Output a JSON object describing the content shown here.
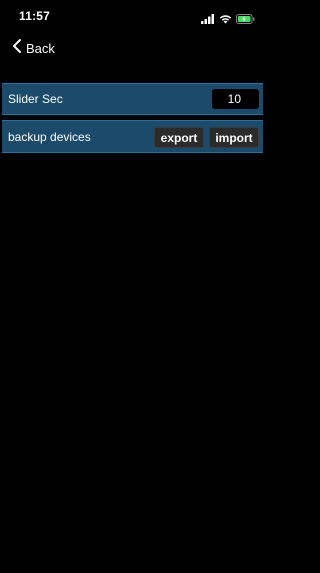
{
  "status_bar": {
    "time": "11:57",
    "icons": [
      "cellular-signal-icon",
      "wifi-icon",
      "battery-charging-icon"
    ]
  },
  "nav": {
    "back_label": "Back",
    "back_icon": "chevron-left-icon"
  },
  "settings": {
    "slider_sec": {
      "label": "Slider Sec",
      "value": "10"
    },
    "backup_devices": {
      "label": "backup devices",
      "export_label": "export",
      "import_label": "import"
    }
  },
  "colors": {
    "background": "#000000",
    "row_background": "#1b4a6b",
    "row_border": "#2f6e97",
    "battery_fill": "#4cd964"
  }
}
